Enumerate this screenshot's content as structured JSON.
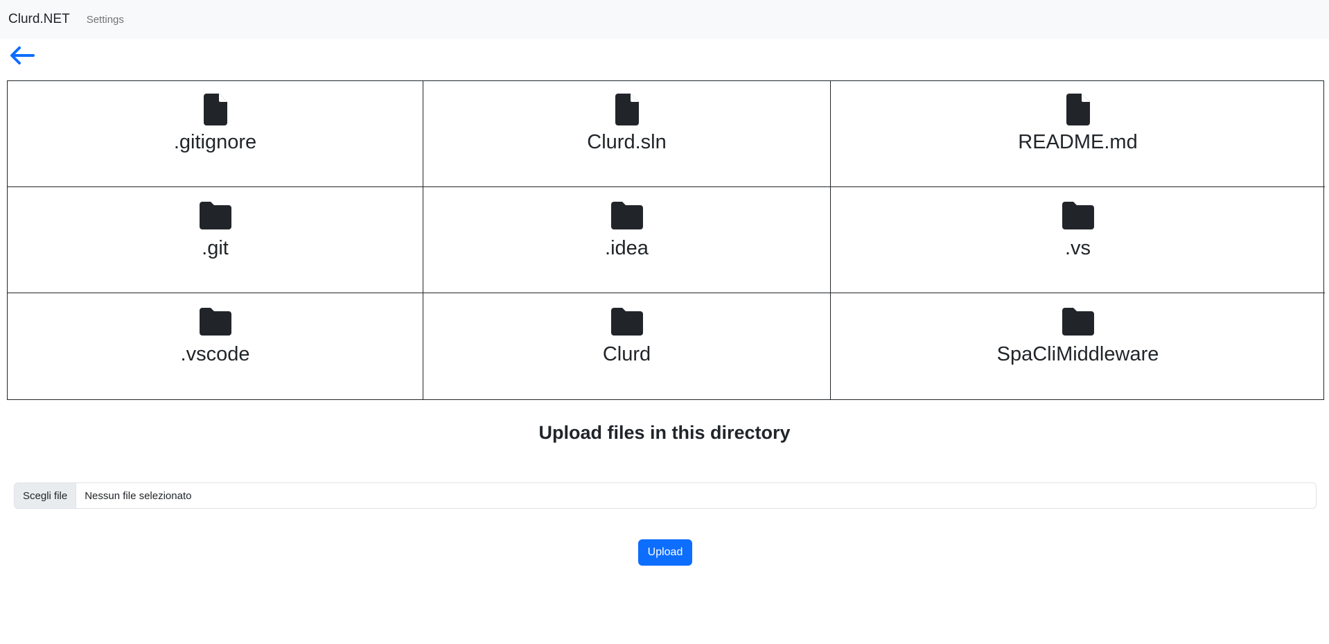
{
  "navbar": {
    "brand": "Clurd.NET",
    "settings_link": "Settings"
  },
  "back": {
    "icon": "arrow-left-icon",
    "color": "#0d6efd"
  },
  "entries": [
    {
      "name": ".gitignore",
      "type": "file",
      "icon": "file-icon"
    },
    {
      "name": "Clurd.sln",
      "type": "file",
      "icon": "file-icon"
    },
    {
      "name": "README.md",
      "type": "file",
      "icon": "file-icon"
    },
    {
      "name": ".git",
      "type": "folder",
      "icon": "folder-icon"
    },
    {
      "name": ".idea",
      "type": "folder",
      "icon": "folder-icon"
    },
    {
      "name": ".vs",
      "type": "folder",
      "icon": "folder-icon"
    },
    {
      "name": ".vscode",
      "type": "folder",
      "icon": "folder-icon"
    },
    {
      "name": "Clurd",
      "type": "folder",
      "icon": "folder-icon"
    },
    {
      "name": "SpaCliMiddleware",
      "type": "folder",
      "icon": "folder-icon"
    }
  ],
  "upload": {
    "title": "Upload files in this directory",
    "choose_button": "Scegli file",
    "no_file_text": "Nessun file selezionato",
    "submit_label": "Upload",
    "accent_color": "#0d6efd"
  }
}
